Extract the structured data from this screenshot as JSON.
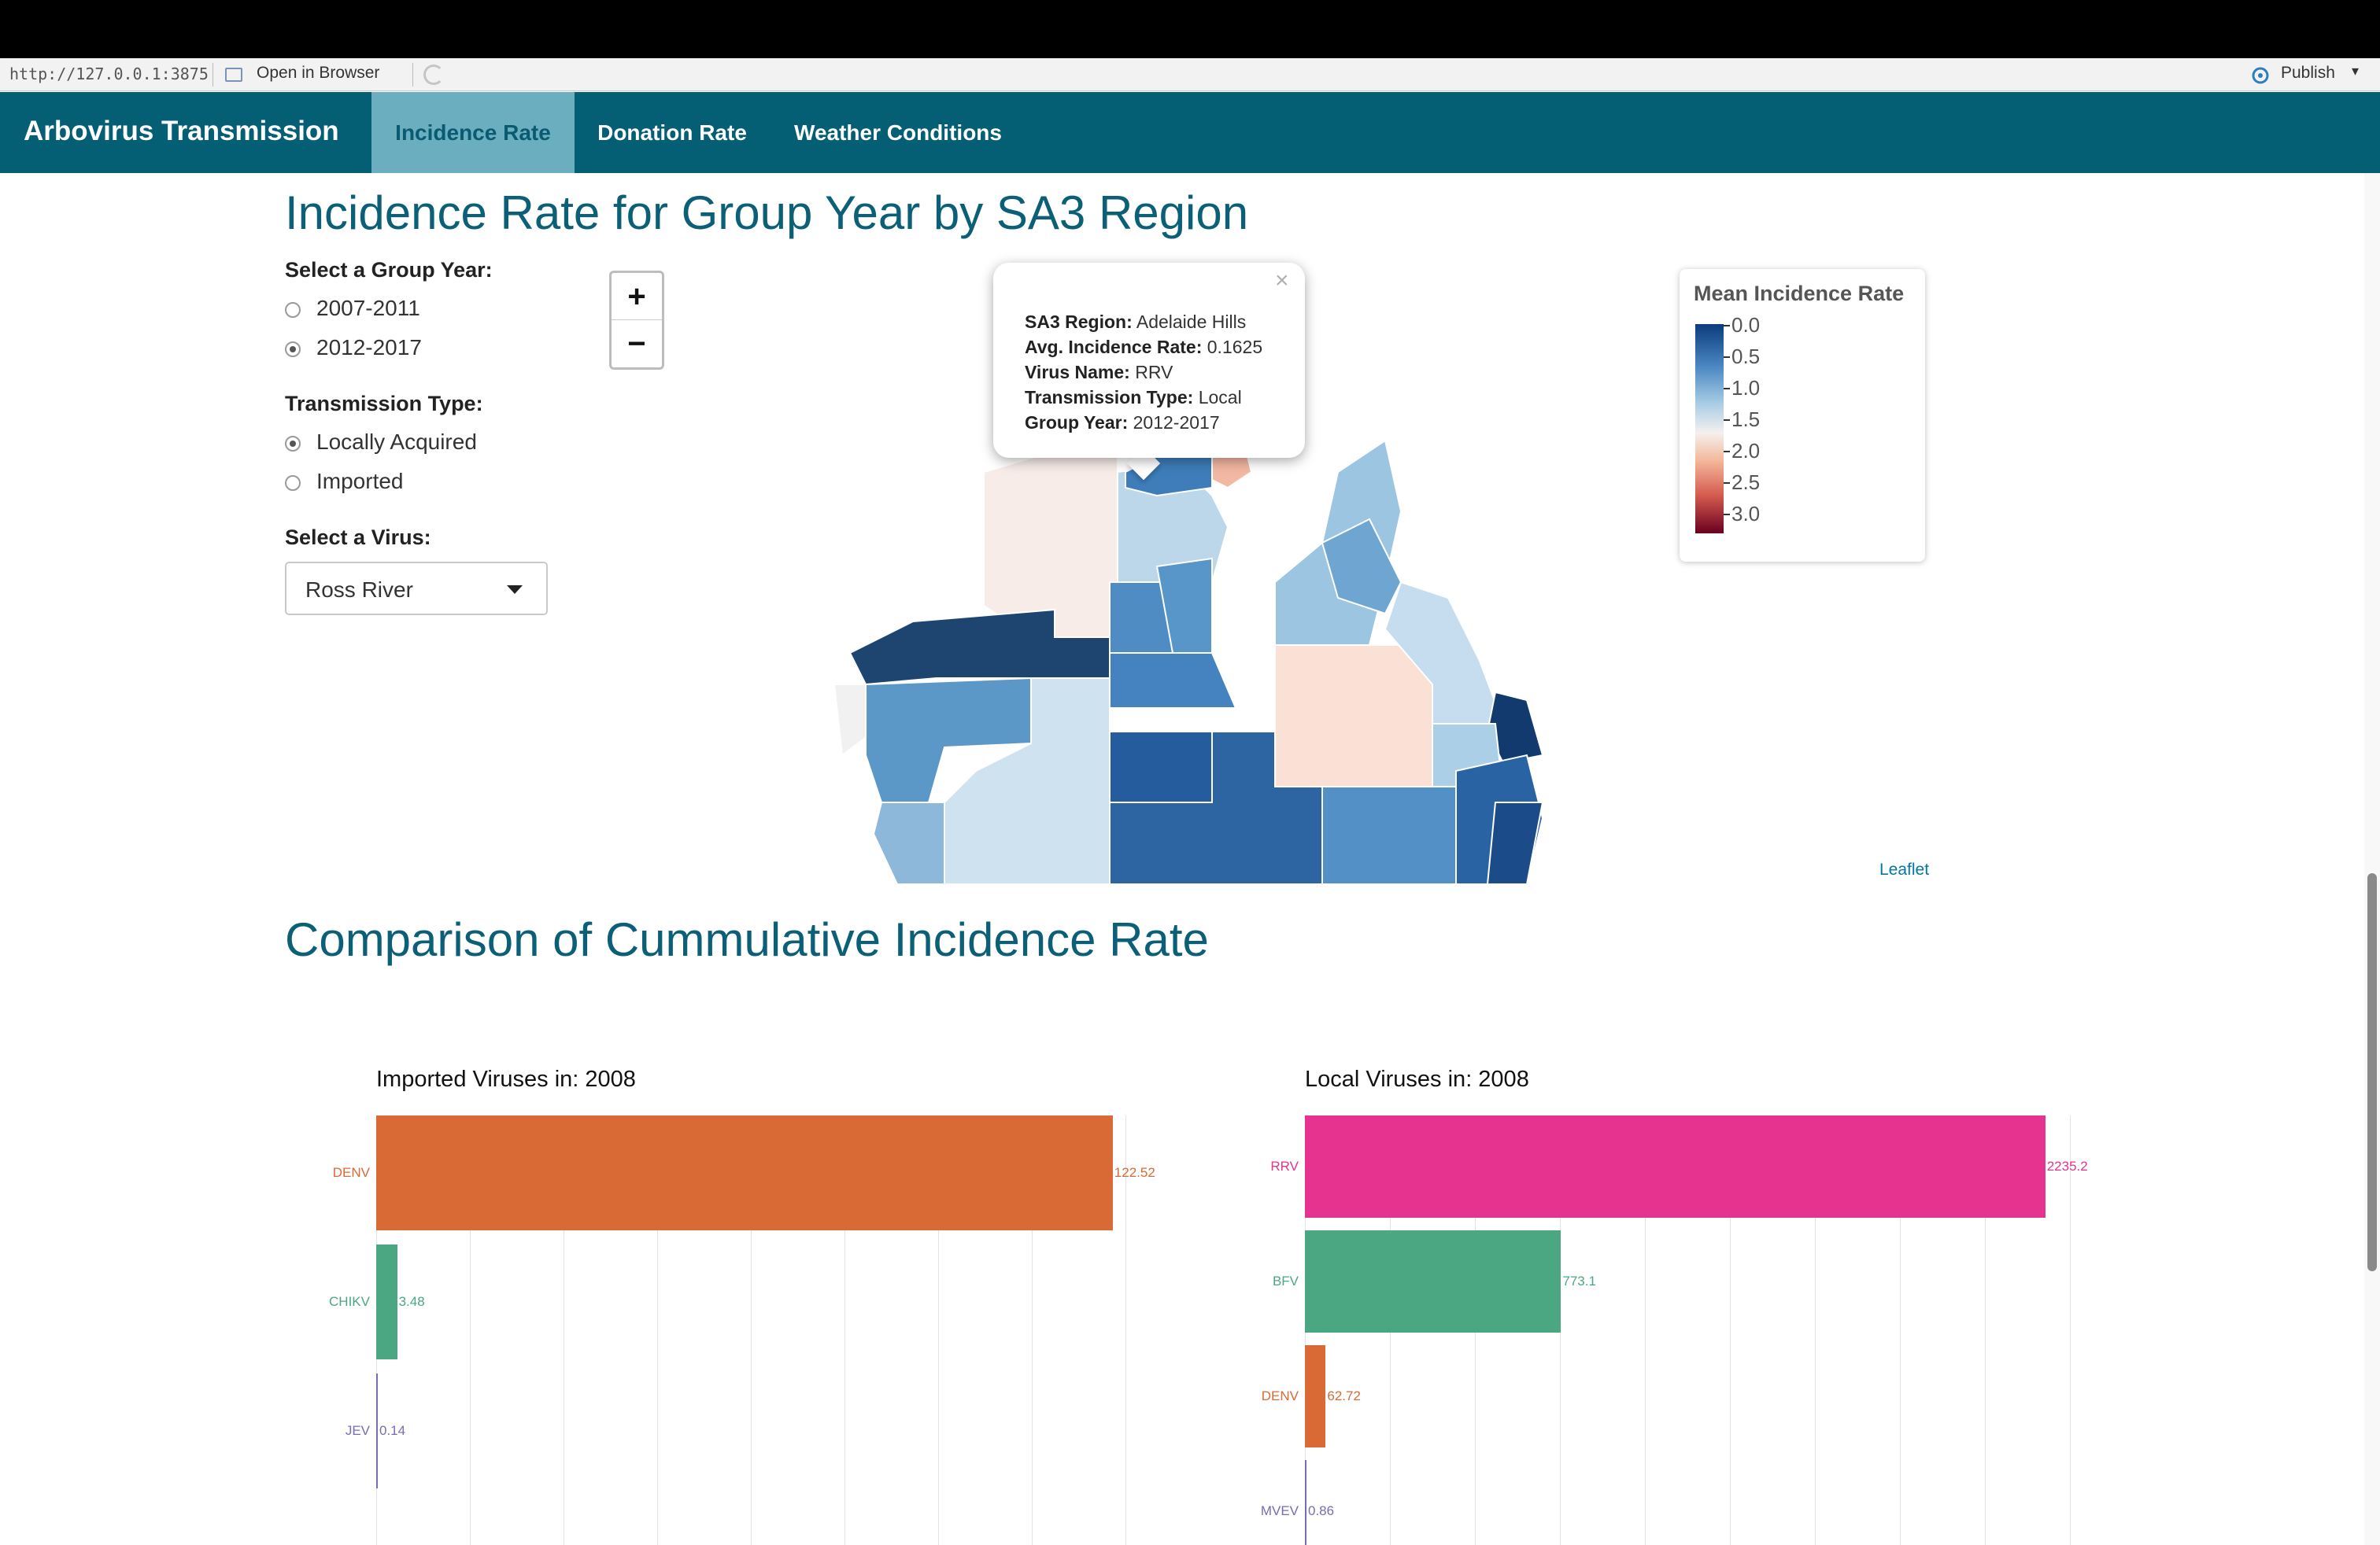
{
  "viewer": {
    "url": "http://127.0.0.1:3875",
    "open_in_browser": "Open in Browser",
    "publish": "Publish"
  },
  "navbar": {
    "brand": "Arbovirus Transmission",
    "tabs": [
      {
        "label": "Incidence Rate",
        "active": true
      },
      {
        "label": "Donation Rate",
        "active": false
      },
      {
        "label": "Weather Conditions",
        "active": false
      }
    ]
  },
  "section1": {
    "heading": "Incidence Rate for Group Year by SA3 Region",
    "group_year": {
      "label": "Select a Group Year:",
      "options": [
        {
          "label": "2007-2011",
          "checked": false
        },
        {
          "label": "2012-2017",
          "checked": true
        }
      ]
    },
    "transmission": {
      "label": "Transmission Type:",
      "options": [
        {
          "label": "Locally Acquired",
          "checked": true
        },
        {
          "label": "Imported",
          "checked": false
        }
      ]
    },
    "virus": {
      "label": "Select a Virus:",
      "selected": "Ross River"
    },
    "zoom": {
      "in": "+",
      "out": "−"
    },
    "popup": {
      "close": "×",
      "rows": [
        {
          "key": "SA3 Region:",
          "value": "Adelaide Hills"
        },
        {
          "key": "Avg. Incidence Rate:",
          "value": "0.1625"
        },
        {
          "key": "Virus Name:",
          "value": "RRV"
        },
        {
          "key": "Transmission Type:",
          "value": "Local"
        },
        {
          "key": "Group Year:",
          "value": "2012-2017"
        }
      ]
    },
    "legend": {
      "title": "Mean Incidence Rate",
      "ticks": [
        "0.0",
        "0.5",
        "1.0",
        "1.5",
        "2.0",
        "2.5",
        "3.0"
      ],
      "colors": [
        "#0b3c7d",
        "#4a86c2",
        "#a8cde5",
        "#f5f0ee",
        "#f4b99c",
        "#d45a4e",
        "#6a0020"
      ]
    },
    "attribution": "Leaflet"
  },
  "section2": {
    "heading": "Comparison of Cummulative Incidence Rate"
  },
  "chart_data": [
    {
      "type": "bar",
      "orientation": "horizontal",
      "title": "Imported Viruses in: 2008",
      "categories": [
        "DENV",
        "CHIKV",
        "JEV"
      ],
      "values": [
        122.52,
        3.48,
        0.14
      ],
      "labels": [
        "122.52",
        "3.48",
        "0.14"
      ],
      "colors": [
        "#d96a35",
        "#4aa782",
        "#7b6bb5"
      ],
      "xlim": [
        0,
        127
      ],
      "grid": true
    },
    {
      "type": "bar",
      "orientation": "horizontal",
      "title": "Local Viruses in: 2008",
      "categories": [
        "RRV",
        "BFV",
        "DENV",
        "MVEV"
      ],
      "values": [
        2235.2,
        773.1,
        62.72,
        0.86
      ],
      "labels": [
        "2235.2",
        "773.1",
        "62.72",
        "0.86"
      ],
      "colors": [
        "#e5338f",
        "#4aa782",
        "#d96a35",
        "#7b6bb5"
      ],
      "xlim": [
        0,
        2300
      ],
      "grid": true
    }
  ]
}
